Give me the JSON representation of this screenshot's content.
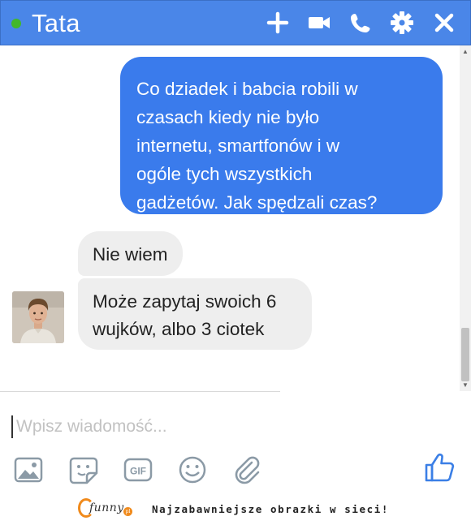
{
  "header": {
    "contact_name": "Tata",
    "online_status": "online",
    "background_color": "#4a86e8",
    "icons": [
      "add-people-icon",
      "video-call-icon",
      "phone-call-icon",
      "settings-gear-icon",
      "close-icon"
    ]
  },
  "messages": {
    "outgoing": {
      "lines": [
        "Co dziadek i babcia robili w",
        "czasach kiedy nie było",
        "internetu, smartfonów i w",
        "ogóle tych wszystkich",
        "gadżetów. Jak spędzali czas?"
      ],
      "bubble_color": "#3a7bec"
    },
    "incoming": [
      {
        "lines": [
          "Nie wiem"
        ]
      },
      {
        "lines": [
          "Może zapytaj swoich 6",
          "wujków, albo 3 ciotek"
        ]
      }
    ],
    "incoming_bubble_color": "#eeeeee"
  },
  "composer": {
    "placeholder": "Wpisz wiadomość...",
    "value": "",
    "tools": [
      "photo-icon",
      "sticker-icon",
      "gif-icon",
      "emoji-icon",
      "attachment-icon"
    ],
    "gif_label": "GIF",
    "like_icon": "thumbs-up-icon"
  },
  "footer": {
    "logo_text": "funny",
    "logo_badge": "pl",
    "tagline": "Najzabawniejsze obrazki w sieci!",
    "accent_color": "#f08a1c"
  }
}
